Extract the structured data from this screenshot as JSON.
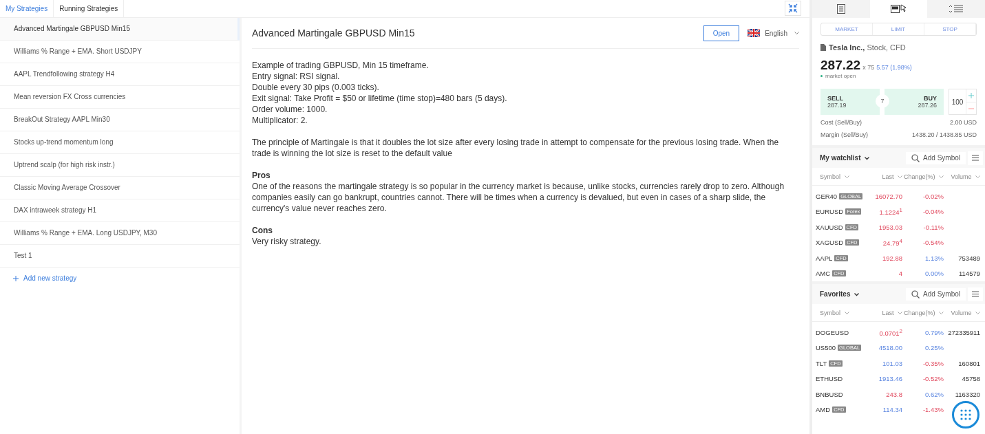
{
  "tabs": [
    {
      "label": "My Strategies",
      "selected": true
    },
    {
      "label": "Running Strategies",
      "selected": false
    }
  ],
  "strategies": [
    {
      "name": "Advanced Martingale GBPUSD Min15",
      "selected": true
    },
    {
      "name": "Williams % Range + EMA. Short USDJPY",
      "selected": false
    },
    {
      "name": "AAPL Trendfollowing strategy H4",
      "selected": false
    },
    {
      "name": "Mean reversion FX Cross currencies",
      "selected": false
    },
    {
      "name": "BreakOut Strategy AAPL Min30",
      "selected": false
    },
    {
      "name": "Stocks up-trend momentum long",
      "selected": false
    },
    {
      "name": "Uptrend scalp (for high risk instr.)",
      "selected": false
    },
    {
      "name": "Classic Moving Average Crossover",
      "selected": false
    },
    {
      "name": "DAX intraweek strategy H1",
      "selected": false
    },
    {
      "name": "Williams % Range + EMA. Long USDJPY, M30",
      "selected": false
    },
    {
      "name": "Test 1",
      "selected": false
    }
  ],
  "add_strategy": "Add new strategy",
  "detail": {
    "title": "Advanced Martingale GBPUSD Min15",
    "open_button": "Open",
    "language": "English",
    "blocks": [
      {
        "kind": "lines",
        "lines": [
          "Example of trading GBPUSD, Min 15 timeframe.",
          "Entry signal: RSI signal.",
          "Double every 30 pips (0.003 ticks).",
          "Exit signal: Take Profit = $50 or lifetime (time stop)=480 bars (5 days).",
          "Order volume: 1000.",
          "Multiplicator: 2."
        ]
      },
      {
        "kind": "paragraph",
        "text": "The principle of Martingale is that it doubles the lot size after every losing trade in attempt to compensate for the previous losing trade. When the trade is winning the lot size is reset to the default value"
      },
      {
        "kind": "section",
        "heading": "Pros",
        "text": "One of the reasons the martingale strategy is so popular in the currency market is because, unlike stocks, currencies rarely drop to zero. Although companies easily can go bankrupt, countries cannot. There will be times when a currency is devalued, but even in cases of a sharp slide, the currency's value never reaches zero."
      },
      {
        "kind": "section",
        "heading": "Cons",
        "text": "Very risky strategy."
      }
    ]
  },
  "panel_tabs": [
    {
      "selected": false
    },
    {
      "selected": true
    },
    {
      "selected": false
    }
  ],
  "order_types": [
    "MARKET",
    "LIMIT",
    "STOP"
  ],
  "instrument": {
    "name": "Tesla Inc.,",
    "type": "Stock, CFD",
    "price": "287.22",
    "multiplier": "x 75",
    "change": "5.57 (1.98%)",
    "status": "market open",
    "sell_label": "SELL",
    "sell": "287.19",
    "spread": "7",
    "buy_label": "BUY",
    "buy": "287.26",
    "quantity": "100",
    "costs": [
      {
        "label": "Cost (Sell/Buy)",
        "value": "2.00 USD"
      },
      {
        "label": "Margin (Sell/Buy)",
        "value": "1438.20 / 1438.85 USD"
      }
    ]
  },
  "lists": [
    {
      "title": "My watchlist",
      "add_symbol": "Add Symbol",
      "columns": [
        "Symbol",
        "Last",
        "Change(%)",
        "Volume"
      ],
      "rows": [
        {
          "symbol": "GER40",
          "tag": "GLOBAL",
          "last": "16072.70",
          "last_up": false,
          "change": "-0.02%",
          "change_up": false
        },
        {
          "symbol": "EURUSD",
          "tag": "Forex",
          "last": "1.1224$^{1}$",
          "last_up": false,
          "change": "-0.04%",
          "change_up": false
        },
        {
          "symbol": "XAUUSD",
          "tag": "CFD",
          "last": "1953.03",
          "last_up": false,
          "change": "-0.11%",
          "change_up": false
        },
        {
          "symbol": "XAGUSD",
          "tag": "CFD",
          "last": "24.79$^{4}$",
          "last_up": false,
          "change": "-0.54%",
          "change_up": false
        },
        {
          "symbol": "AAPL",
          "tag": "CFD",
          "last": "192.88",
          "last_up": false,
          "change": "1.13%",
          "change_up": true,
          "volume": "753489"
        },
        {
          "symbol": "AMC",
          "tag": "CFD",
          "last": "4",
          "last_up": false,
          "change": "0.00%",
          "change_up": true,
          "volume": "114579"
        }
      ]
    },
    {
      "title": "Favorites",
      "add_symbol": "Add Symbol",
      "columns": [
        "Symbol",
        "Last",
        "Change(%)",
        "Volume"
      ],
      "rows": [
        {
          "symbol": "DOGEUSD",
          "last": "0.0701$^{2}$",
          "last_up": false,
          "change": "0.79%",
          "change_up": true,
          "volume": "272335911"
        },
        {
          "symbol": "US500",
          "tag": "GLOBAL",
          "last": "4518.00",
          "last_up": true,
          "change": "0.25%",
          "change_up": true
        },
        {
          "symbol": "TLT",
          "tag": "CFD",
          "last": "101.03",
          "last_up": true,
          "change": "-0.35%",
          "change_up": false,
          "volume": "160801"
        },
        {
          "symbol": "ETHUSD",
          "last": "1913.46",
          "last_up": true,
          "change": "-0.52%",
          "change_up": false,
          "volume": "45758"
        },
        {
          "symbol": "BNBUSD",
          "last": "243.8",
          "last_up": false,
          "change": "0.62%",
          "change_up": true,
          "volume": "1163320"
        },
        {
          "symbol": "AMD",
          "tag": "CFD",
          "last": "114.34",
          "last_up": true,
          "change": "-1.43%",
          "change_up": false
        }
      ]
    }
  ]
}
